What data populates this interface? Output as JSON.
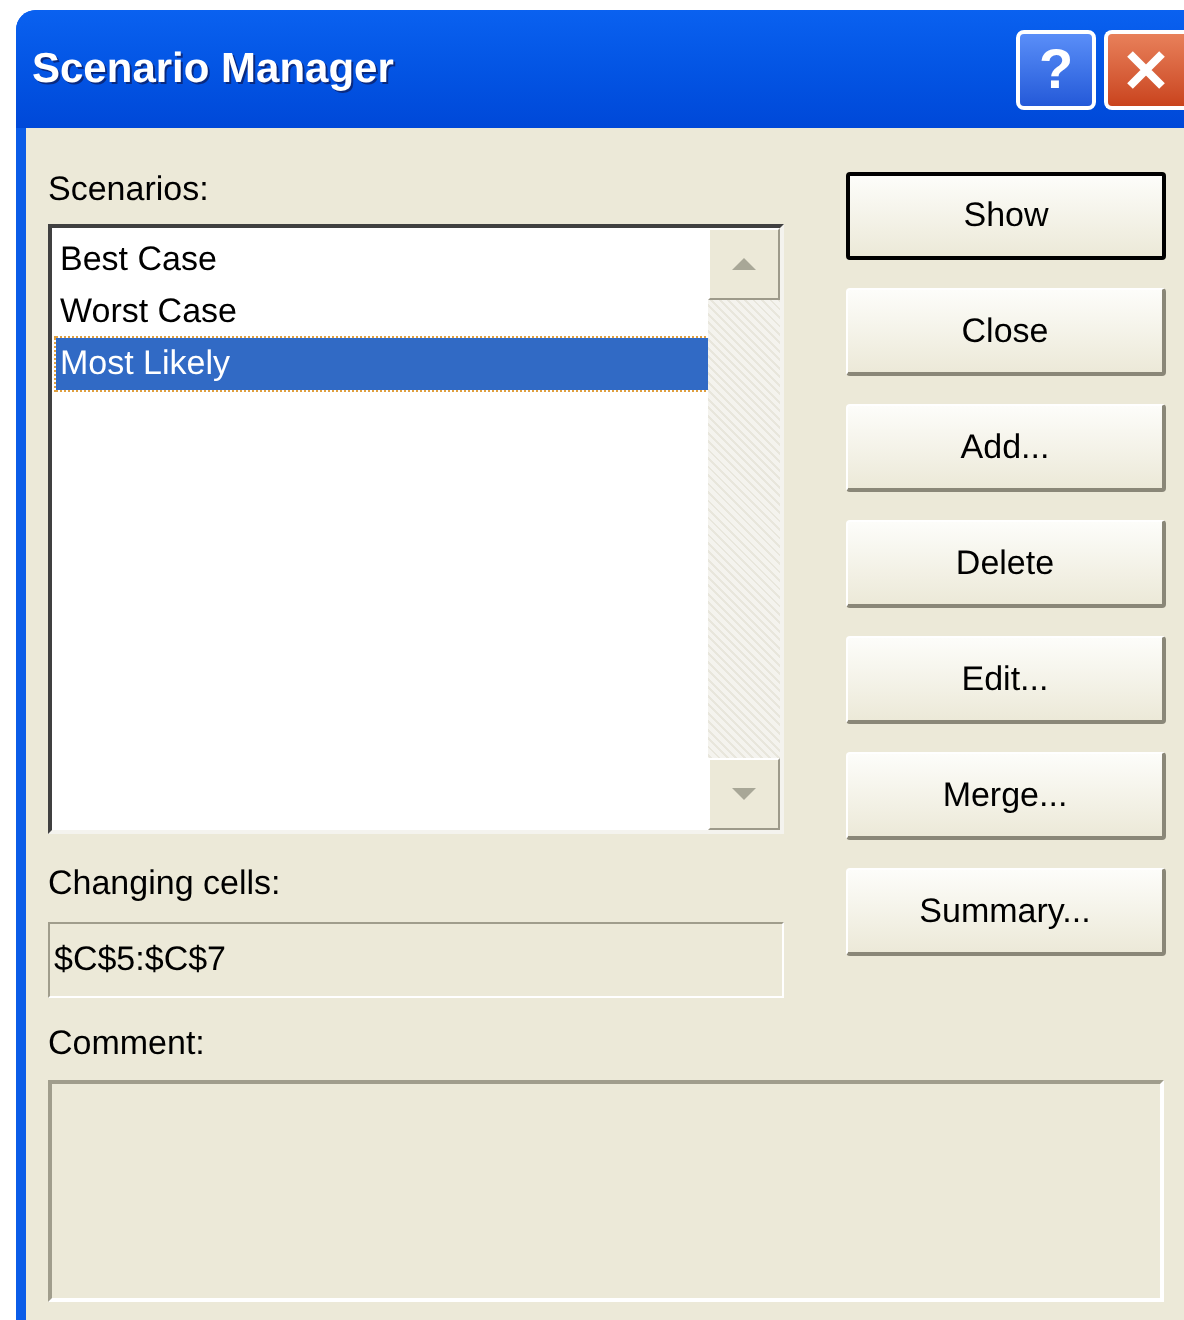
{
  "window": {
    "title": "Scenario Manager",
    "title_buttons": [
      {
        "kind": "help",
        "label": "?"
      },
      {
        "kind": "close"
      }
    ]
  },
  "scenarios": {
    "label": "Scenarios:",
    "items": [
      {
        "label": "Best Case",
        "selected": false
      },
      {
        "label": "Worst Case",
        "selected": false
      },
      {
        "label": "Most Likely",
        "selected": true
      }
    ]
  },
  "buttons": [
    {
      "label": "Show",
      "focused": true
    },
    {
      "label": "Close",
      "focused": false
    },
    {
      "label": "Add...",
      "focused": false
    },
    {
      "label": "Delete",
      "focused": false
    },
    {
      "label": "Edit...",
      "focused": false
    },
    {
      "label": "Merge...",
      "focused": false
    },
    {
      "label": "Summary...",
      "focused": false
    }
  ],
  "changing_cells": {
    "label": "Changing cells:",
    "value": "$C$5:$C$7"
  },
  "comment": {
    "label": "Comment:"
  }
}
